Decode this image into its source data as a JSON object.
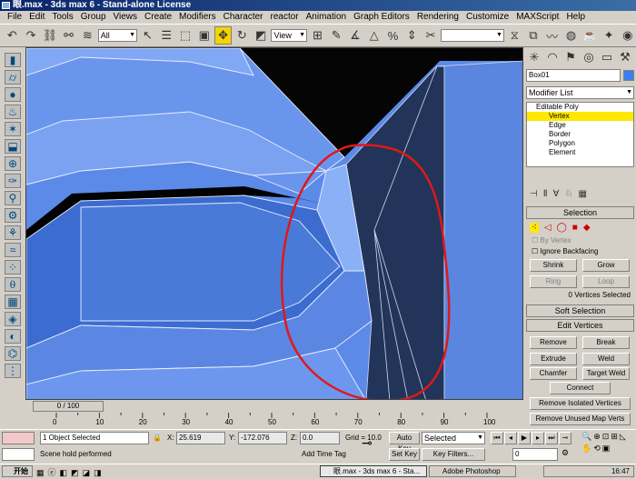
{
  "window": {
    "title": "眼.max - 3ds max 6 - Stand-alone License"
  },
  "menu": [
    "File",
    "Edit",
    "Tools",
    "Group",
    "Views",
    "Create",
    "Modifiers",
    "Character",
    "reactor",
    "Animation",
    "Graph Editors",
    "Rendering",
    "Customize",
    "MAXScript",
    "Help"
  ],
  "toolbar": {
    "selection_filter": "All",
    "ref_coord": "View"
  },
  "right_panel": {
    "object_name": "Box01",
    "modifier_list": "Modifier List",
    "stack": {
      "root": "Editable Poly",
      "items": [
        "Vertex",
        "Edge",
        "Border",
        "Polygon",
        "Element"
      ],
      "selected": "Vertex"
    },
    "selection": {
      "title": "Selection",
      "by_vertex": "By Vertex",
      "ignore_backfacing": "Ignore Backfacing",
      "shrink": "Shrink",
      "grow": "Grow",
      "ring": "Ring",
      "loop": "Loop",
      "status": "0 Vertices Selected"
    },
    "soft_selection": "Soft Selection",
    "edit_vertices": {
      "title": "Edit Vertices",
      "remove": "Remove",
      "break": "Break",
      "extrude": "Extrude",
      "weld": "Weld",
      "chamfer": "Chamfer",
      "target_weld": "Target Weld",
      "connect": "Connect",
      "remove_isolated": "Remove Isolated Vertices",
      "remove_unused": "Remove Unused Map Verts"
    }
  },
  "timeline": {
    "frame": "0 / 100",
    "ticks": [
      "0",
      "10",
      "20",
      "30",
      "40",
      "50",
      "60",
      "70",
      "80",
      "90",
      "100"
    ]
  },
  "status_bar": {
    "selected": "1 Object Selected",
    "prompt": "Scene hold performed",
    "x_label": "X:",
    "x": "25.619",
    "y_label": "Y:",
    "y": "-172.076",
    "z_label": "Z:",
    "z": "0.0",
    "grid": "Grid = 10.0",
    "add_time_tag": "Add Time Tag",
    "auto_key": "Auto Key",
    "key_mode": "Selected",
    "set_key": "Set Key",
    "key_filters": "Key Filters...",
    "frame_field": "0"
  },
  "taskbar": {
    "start": "开始",
    "tasks": [
      "眼.max - 3ds max 6 - Sta...",
      "Adobe Photoshop"
    ],
    "clock": "16:47"
  }
}
